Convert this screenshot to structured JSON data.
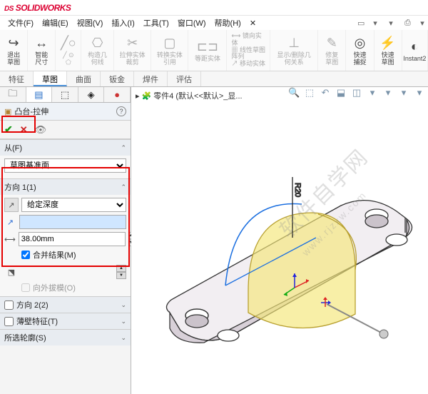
{
  "app": {
    "logo_prefix": "DS",
    "logo": "SOLIDWORKS"
  },
  "menu": {
    "file": "文件(F)",
    "edit": "编辑(E)",
    "view": "视图(V)",
    "insert": "插入(I)",
    "tools": "工具(T)",
    "window": "窗口(W)",
    "help": "帮助(H)"
  },
  "ribbon": {
    "exit_sketch": "退出草图",
    "smart_dim": "智能尺寸",
    "draw": "构造几何线",
    "cut_solid": "拉伸实体裁剪",
    "convert": "转换实体引用",
    "chamfer": "等距实体",
    "mirror": "镜向实体",
    "pattern": "线性草图阵列",
    "move": "移动实体",
    "show": "显示/删除几何关系",
    "repair": "修复草图",
    "quick_snap": "快速捕捉",
    "rapid_sketch": "快速草图",
    "instant": "Instant2"
  },
  "tabs": {
    "feature": "特征",
    "sketch": "草图",
    "surface": "曲面",
    "sheet": "钣金",
    "weld": "焊件",
    "eval": "评估"
  },
  "panel": {
    "title": "凸台-拉伸",
    "from_label": "从(F)",
    "from_value": "草图基准面",
    "dir1_label": "方向 1(1)",
    "end_cond": "给定深度",
    "distance_value": "",
    "depth_value": "38.00mm",
    "merge_label": "合并结果(M)",
    "draft_label": "向外拔模(O)",
    "dir2_label": "方向 2(2)",
    "thin_label": "薄壁特征(T)",
    "sel_label": "所选轮廓(S)"
  },
  "breadcrumb": {
    "part": "零件4",
    "state": "(默认<<默认>_显..."
  },
  "model": {
    "radius_label": "R20"
  }
}
